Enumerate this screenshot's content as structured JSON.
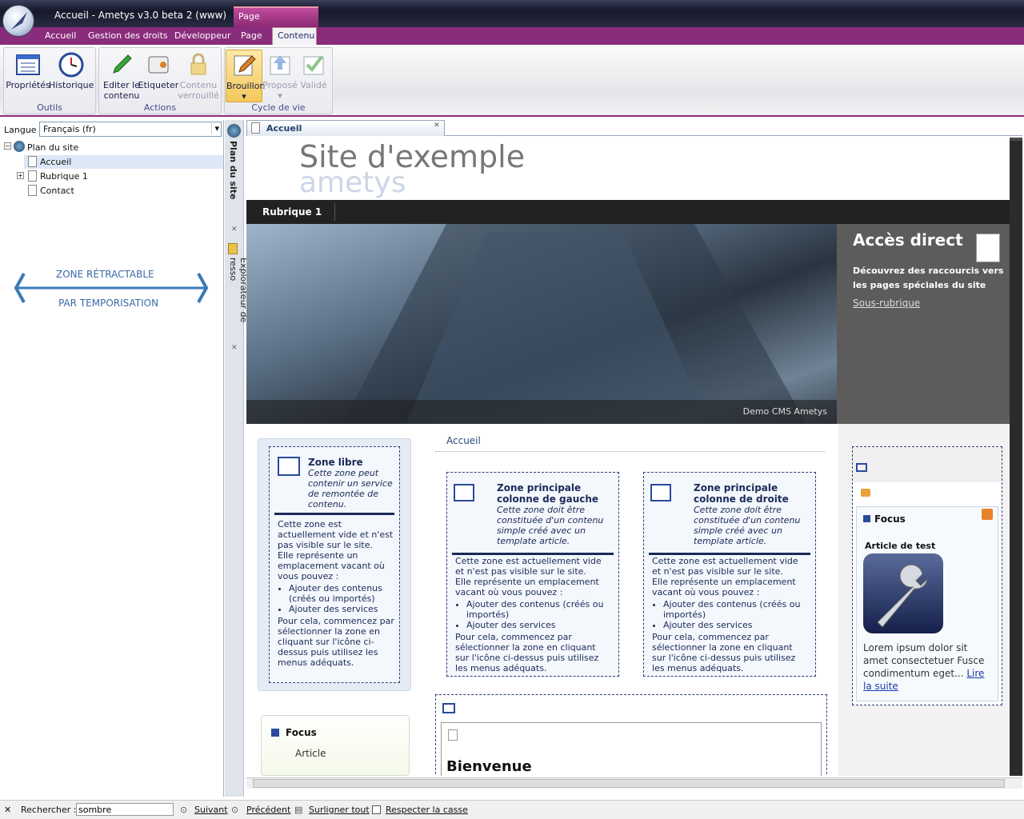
{
  "window": {
    "title": "Accueil - Ametys v3.0 beta 2 (www)",
    "context_tab": "Page"
  },
  "ribbon_tabs": [
    "Accueil",
    "Gestion des droits",
    "Développeur",
    "Page",
    "Contenu"
  ],
  "groups": {
    "outils": {
      "label": "Outils",
      "buttons": [
        {
          "label": "Propriétés",
          "icon": "properties-icon"
        },
        {
          "label": "Historique",
          "icon": "clock-icon"
        }
      ]
    },
    "actions": {
      "label": "Actions",
      "buttons": [
        {
          "label": "Editer le contenu",
          "icon": "pencil-icon"
        },
        {
          "label": "Etiqueter",
          "icon": "tag-icon"
        },
        {
          "label": "Contenu verrouillé",
          "icon": "lock-icon"
        }
      ]
    },
    "cycle": {
      "label": "Cycle de vie",
      "buttons": [
        {
          "label": "Brouillon",
          "icon": "draft-icon"
        },
        {
          "label": "Proposé",
          "icon": "propose-icon"
        },
        {
          "label": "Validé",
          "icon": "validate-icon"
        }
      ]
    }
  },
  "left": {
    "lang_label": "Langue",
    "lang_value": "Français (fr)",
    "tree": {
      "root": "Plan du site",
      "items": [
        "Accueil",
        "Rubrique 1",
        "Contact"
      ]
    },
    "zone_line1": "ZONE RÉTRACTABLE",
    "zone_line2": "PAR TEMPORISATION"
  },
  "vtabs": [
    "Plan du site",
    "Explorateur de resso"
  ],
  "doc_tab": "Accueil",
  "site": {
    "title": "Site d'exemple",
    "subtitle": "ametys",
    "nav_item": "Rubrique 1",
    "hero_caption": "Demo CMS Ametys",
    "acces_title": "Accès direct",
    "acces_text": "Découvrez des raccourcis vers les pages spéciales du site",
    "acces_link": "Sous-rubrique",
    "breadcrumb": "Accueil",
    "zone_libre": {
      "title": "Zone libre",
      "sub": "Cette zone peut contenir un service de remontée de contenu.",
      "body1": "Cette zone est actuellement vide et n'est pas visible sur le site.",
      "body2": "Elle représente un emplacement vacant où vous pouvez :",
      "li1": "Ajouter des contenus (créés ou importés)",
      "li2": "Ajouter des services",
      "body3": "Pour cela, commencez par sélectionner la zone en cliquant sur l'icône ci-dessus puis utilisez les menus adéquats."
    },
    "zone_gauche": {
      "title": "Zone principale colonne de gauche",
      "sub": "Cette zone doit être constituée d'un contenu simple créé avec un template article.",
      "body1": "Cette zone est actuellement vide et n'est pas visible sur le site.",
      "body2": "Elle représente un emplacement vacant où vous pouvez :",
      "li1": "Ajouter des contenus (créés ou importés)",
      "li2": "Ajouter des services",
      "body3": "Pour cela, commencez par sélectionner la zone en cliquant sur l'icône ci-dessus puis utilisez les menus adéquats."
    },
    "zone_droite": {
      "title": "Zone principale colonne de droite",
      "sub": "Cette zone doit être constituée d'un contenu simple créé avec un template article.",
      "body1": "Cette zone est actuellement vide et n'est pas visible sur le site.",
      "body2": "Elle représente un emplacement vacant où vous pouvez :",
      "li1": "Ajouter des contenus (créés ou importés)",
      "li2": "Ajouter des services",
      "body3": "Pour cela, commencez par sélectionner la zone en cliquant sur l'icône ci-dessus puis utilisez les menus adéquats."
    },
    "focus_left": {
      "title": "Focus",
      "item": "Article"
    },
    "bienvenue": "Bienvenue",
    "focus_right": {
      "title": "Focus",
      "article": "Article de test",
      "text": "Lorem ipsum dolor sit amet consectetuer Fusce condimentum eget...",
      "link": "Lire la suite"
    }
  },
  "status": {
    "close": "✕",
    "search_label": "Rechercher :",
    "search_value": "sombre",
    "next": "Suivant",
    "prev": "Précédent",
    "highlight": "Surligner tout",
    "case": "Respecter la casse"
  }
}
